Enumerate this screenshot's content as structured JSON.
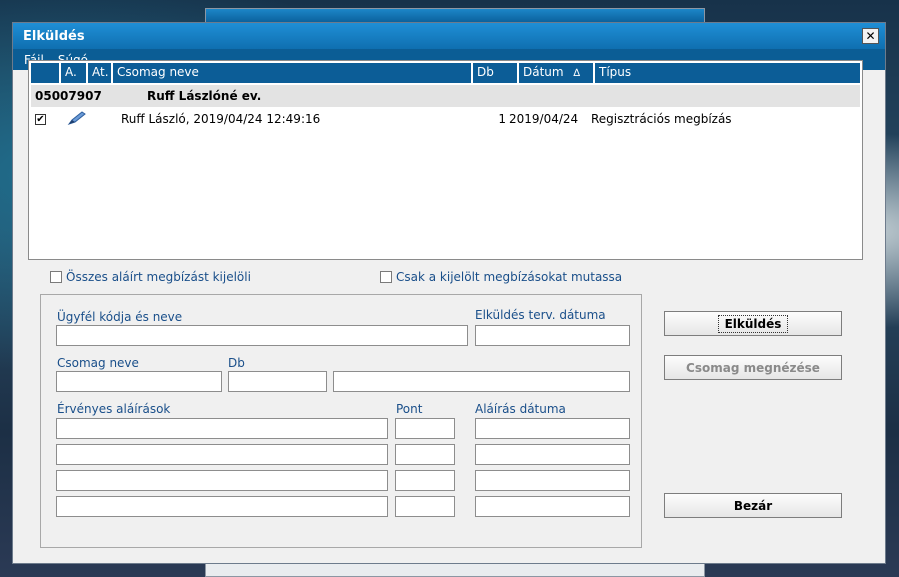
{
  "dialog": {
    "title": "Elküldés",
    "close_glyph": "✕"
  },
  "menu": [
    "Fájl",
    "Súgó"
  ],
  "list": {
    "columns": [
      "A.",
      "At.",
      "Csomag neve",
      "Db",
      "Dátum",
      "Típus"
    ],
    "sort_glyph": "∆",
    "group": {
      "code": "05007907",
      "name": "Ruff Lászlóné ev."
    },
    "rows": [
      {
        "checked": "✔",
        "icon": "pen-icon",
        "name": "Ruff László, 2019/04/24 12:49:16",
        "db": "1",
        "date": "2019/04/24",
        "type": "Regisztrációs megbízás"
      }
    ]
  },
  "options": {
    "select_all": "Összes aláírt megbízást kijelöli",
    "show_selected": "Csak a kijelölt megbízásokat mutassa"
  },
  "form": {
    "client_label": "Ügyfél kódja és neve",
    "send_date_label": "Elküldés terv. dátuma",
    "package_label": "Csomag neve",
    "db_label": "Db",
    "signatures_label": "Érvényes aláírások",
    "point_label": "Pont",
    "sign_date_label": "Aláírás dátuma"
  },
  "buttons": {
    "send": "Elküldés",
    "view": "Csomag megnézése",
    "close": "Bezár"
  },
  "colors": {
    "accent": "#0c5d97",
    "label": "#1a4f8a"
  }
}
